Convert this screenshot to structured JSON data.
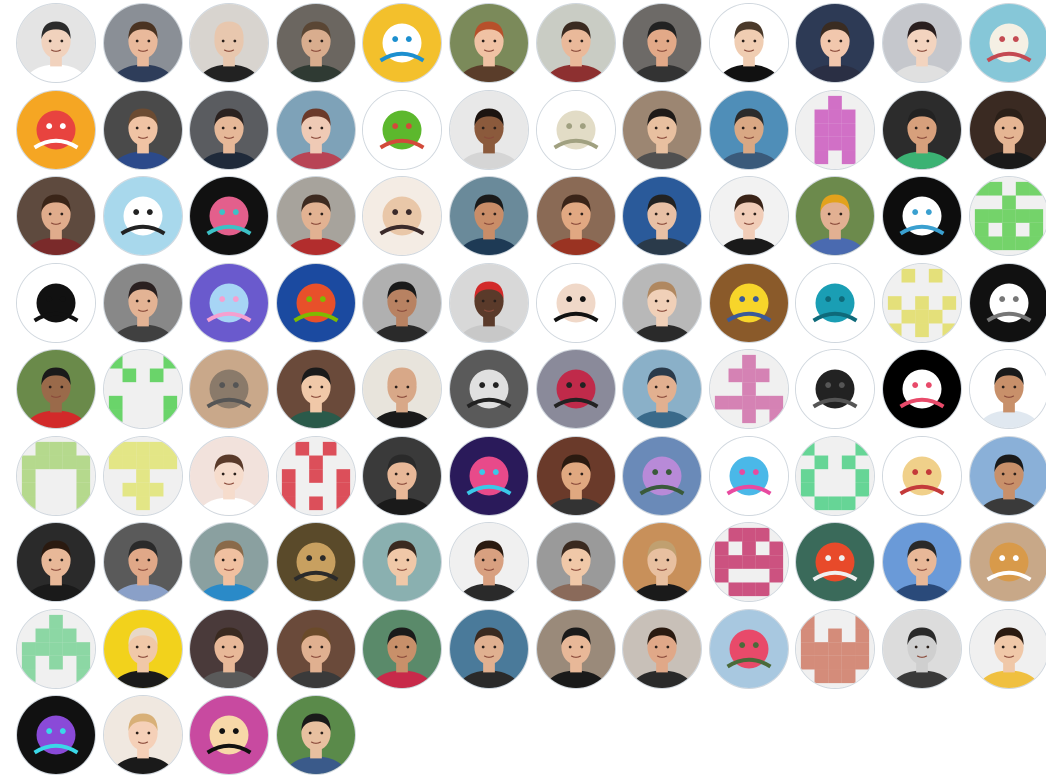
{
  "contributors": [
    {
      "kind": "photo",
      "bg": "#e4e4e4",
      "skin": "#f1d2bd",
      "hair": "#2b2b2b",
      "shirt": "#ffffff"
    },
    {
      "kind": "photo",
      "bg": "#8a8f96",
      "skin": "#e9b99b",
      "hair": "#4a3322",
      "shirt": "#2e3d5a"
    },
    {
      "kind": "photo",
      "bg": "#d8d4cf",
      "skin": "#e8c7ae",
      "hair": "#e8c7ae",
      "shirt": "#222222"
    },
    {
      "kind": "photo",
      "bg": "#6b6660",
      "skin": "#d9ad8e",
      "hair": "#5a4634",
      "shirt": "#2f3a33"
    },
    {
      "kind": "art",
      "bg": "#f3c02c",
      "fg": "#ffffff",
      "accent": "#1c8fcf"
    },
    {
      "kind": "photo",
      "bg": "#7b8a5a",
      "skin": "#f0c2a4",
      "hair": "#b7502b",
      "shirt": "#5a3d2a"
    },
    {
      "kind": "photo",
      "bg": "#c9ccc4",
      "skin": "#eab99a",
      "hair": "#3a2a20",
      "shirt": "#8d3030"
    },
    {
      "kind": "photo",
      "bg": "#6d6a67",
      "skin": "#e2a988",
      "hair": "#222222",
      "shirt": "#333333"
    },
    {
      "kind": "photo",
      "bg": "#ffffff",
      "skin": "#f0cdb2",
      "hair": "#4b3a2b",
      "shirt": "#111111"
    },
    {
      "kind": "photo",
      "bg": "#2d3a55",
      "skin": "#f1c7ad",
      "hair": "#3a2c22",
      "shirt": "#2a2f44"
    },
    {
      "kind": "photo",
      "bg": "#c5c7cc",
      "skin": "#f3d4bf",
      "hair": "#2a1f1f",
      "shirt": "#e0e0e0"
    },
    {
      "kind": "art",
      "bg": "#86c7d8",
      "fg": "#f5f0e4",
      "accent": "#c44a52"
    },
    {
      "kind": "art",
      "bg": "#f5a623",
      "fg": "#e8433f",
      "accent": "#ffffff"
    },
    {
      "kind": "photo",
      "bg": "#4a4a4a",
      "skin": "#f0c3a4",
      "hair": "#6b4b32",
      "shirt": "#2c4a8a"
    },
    {
      "kind": "photo",
      "bg": "#5a5c60",
      "skin": "#e6b898",
      "hair": "#2b2220",
      "shirt": "#1f2a3a"
    },
    {
      "kind": "photo",
      "bg": "#7ea2b8",
      "skin": "#efcab5",
      "hair": "#6b3a2a",
      "shirt": "#b84455"
    },
    {
      "kind": "art",
      "bg": "#ffffff",
      "fg": "#5cb82d",
      "accent": "#d24a3a"
    },
    {
      "kind": "photo",
      "bg": "#e8e8e8",
      "skin": "#8b5a3c",
      "hair": "#1c1410",
      "shirt": "#d5d5d5"
    },
    {
      "kind": "art",
      "bg": "#ffffff",
      "fg": "#e2dcc6",
      "accent": "#a0a080"
    },
    {
      "kind": "photo",
      "bg": "#9c8672",
      "skin": "#e8c0a0",
      "hair": "#1e1a18",
      "shirt": "#505050"
    },
    {
      "kind": "photo",
      "bg": "#4f8eb8",
      "skin": "#d9a884",
      "hair": "#2b2b2b",
      "shirt": "#3a5a7a"
    },
    {
      "kind": "identicon",
      "bg": "#f0f0f0",
      "fg": "#d170c6",
      "pattern": "0010001110011100111001010"
    },
    {
      "kind": "photo",
      "bg": "#2c2c2c",
      "skin": "#d7a07c",
      "hair": "#222222",
      "shirt": "#3bb273"
    },
    {
      "kind": "photo",
      "bg": "#3a2a22",
      "skin": "#e5b593",
      "hair": "#2a1f18",
      "shirt": "#1a1a1a"
    },
    {
      "kind": "photo",
      "bg": "#5e4a3e",
      "skin": "#e0ac8c",
      "hair": "#3a2518",
      "shirt": "#7a2a2a"
    },
    {
      "kind": "art",
      "bg": "#a8d8ec",
      "fg": "#ffffff",
      "accent": "#222222"
    },
    {
      "kind": "art",
      "bg": "#111111",
      "fg": "#e35f8c",
      "accent": "#3cc1c6"
    },
    {
      "kind": "photo",
      "bg": "#a7a39c",
      "skin": "#e2b292",
      "hair": "#3d2a20",
      "shirt": "#b22d2d"
    },
    {
      "kind": "art",
      "bg": "#f4ece4",
      "fg": "#e9c7a8",
      "accent": "#3a2a2a"
    },
    {
      "kind": "photo",
      "bg": "#6a8a9a",
      "skin": "#c98d68",
      "hair": "#1a1a1a",
      "shirt": "#1e3a55"
    },
    {
      "kind": "photo",
      "bg": "#8a6a55",
      "skin": "#e1a882",
      "hair": "#3a2418",
      "shirt": "#9a3322"
    },
    {
      "kind": "photo",
      "bg": "#2a5a9a",
      "skin": "#e8c0a5",
      "hair": "#222222",
      "shirt": "#2a3a4a"
    },
    {
      "kind": "photo",
      "bg": "#f2f2f2",
      "skin": "#f1cdb8",
      "hair": "#3a2418",
      "shirt": "#1a1a1a"
    },
    {
      "kind": "photo",
      "bg": "#6c8a4c",
      "skin": "#e2b092",
      "hair": "#e2a21c",
      "shirt": "#4a6ab0"
    },
    {
      "kind": "art",
      "bg": "#0d0d0d",
      "fg": "#ffffff",
      "accent": "#3aa0d0"
    },
    {
      "kind": "identicon",
      "bg": "#f0f0f0",
      "fg": "#74d36a",
      "pattern": "1101100100111111010111111"
    },
    {
      "kind": "art",
      "bg": "#ffffff",
      "fg": "#111111",
      "accent": "#111111"
    },
    {
      "kind": "photo",
      "bg": "#888888",
      "skin": "#e3b394",
      "hair": "#2a2020",
      "shirt": "#404040"
    },
    {
      "kind": "art",
      "bg": "#6a5acd",
      "fg": "#a7d5f5",
      "accent": "#f5a0d0"
    },
    {
      "kind": "art",
      "bg": "#1b4aa0",
      "fg": "#e8502a",
      "accent": "#7fba00"
    },
    {
      "kind": "photo",
      "bg": "#b0b0b0",
      "skin": "#b88262",
      "hair": "#1a1a1a",
      "shirt": "#2a2a2a"
    },
    {
      "kind": "photo",
      "bg": "#d8d8d8",
      "skin": "#5a3a2a",
      "hair": "#d22a2a",
      "shirt": "#c8c8c8"
    },
    {
      "kind": "art",
      "bg": "#ffffff",
      "fg": "#f0d8c8",
      "accent": "#111111"
    },
    {
      "kind": "photo",
      "bg": "#b8b8b8",
      "skin": "#f0d0b8",
      "hair": "#b08860",
      "shirt": "#2a2a2a"
    },
    {
      "kind": "art",
      "bg": "#8a5a2a",
      "fg": "#f7d52a",
      "accent": "#3a5a9a"
    },
    {
      "kind": "art",
      "bg": "#ffffff",
      "fg": "#1a9eb4",
      "accent": "#0e6a7a"
    },
    {
      "kind": "identicon",
      "bg": "#f0f0f0",
      "fg": "#e4e07a",
      "pattern": "0101000000101010111010101"
    },
    {
      "kind": "art",
      "bg": "#111111",
      "fg": "#ffffff",
      "accent": "#777777"
    },
    {
      "kind": "photo",
      "bg": "#6a8a4a",
      "skin": "#9a6a4a",
      "hair": "#1a1a1a",
      "shirt": "#d22a2a"
    },
    {
      "kind": "identicon",
      "bg": "#f0f0f0",
      "fg": "#6ad46a",
      "pattern": "1000101010000001000110001"
    },
    {
      "kind": "art",
      "bg": "#c9a88a",
      "fg": "#8a7a6a",
      "accent": "#555555"
    },
    {
      "kind": "photo",
      "bg": "#6a4a3a",
      "skin": "#f0c8a8",
      "hair": "#1a1a1a",
      "shirt": "#2a5a4a"
    },
    {
      "kind": "photo",
      "bg": "#e8e4dc",
      "skin": "#d8a888",
      "hair": "#d8a888",
      "shirt": "#1a1a1a"
    },
    {
      "kind": "art",
      "bg": "#5a5a5a",
      "fg": "#e0e0e0",
      "accent": "#222222"
    },
    {
      "kind": "art",
      "bg": "#8a8a9a",
      "fg": "#c02a4a",
      "accent": "#222222"
    },
    {
      "kind": "photo",
      "bg": "#8ab0c8",
      "skin": "#e2b090",
      "hair": "#2a3a4a",
      "shirt": "#3a6a8a"
    },
    {
      "kind": "identicon",
      "bg": "#f0f0f0",
      "fg": "#d582b4",
      "pattern": "0010001110001001111100101"
    },
    {
      "kind": "art",
      "bg": "#ffffff",
      "fg": "#222222",
      "accent": "#555555"
    },
    {
      "kind": "art",
      "bg": "#000000",
      "fg": "#ffffff",
      "accent": "#e84a6a"
    },
    {
      "kind": "photo",
      "bg": "#ffffff",
      "skin": "#c8906a",
      "hair": "#1a1a1a",
      "shirt": "#e0e8f0"
    },
    {
      "kind": "identicon",
      "bg": "#f0f0f0",
      "fg": "#b5d98d",
      "pattern": "0111011111100011000110001"
    },
    {
      "kind": "identicon",
      "bg": "#f0f0f0",
      "fg": "#e3e686",
      "pattern": "1111111111001000111000100"
    },
    {
      "kind": "photo",
      "bg": "#f2e2dc",
      "skin": "#f6dccc",
      "hair": "#5a3a2a",
      "shirt": "#ffffff"
    },
    {
      "kind": "identicon",
      "bg": "#f0f0f0",
      "fg": "#dc4f5a",
      "pattern": "0101000100101011000110101"
    },
    {
      "kind": "photo",
      "bg": "#3a3a3a",
      "skin": "#e8b898",
      "hair": "#2a2a2a",
      "shirt": "#1a1a1a"
    },
    {
      "kind": "art",
      "bg": "#2a1a5a",
      "fg": "#e84a8a",
      "accent": "#3ac8e8"
    },
    {
      "kind": "photo",
      "bg": "#6a3a2a",
      "skin": "#e0a880",
      "hair": "#2a1a10",
      "shirt": "#333333"
    },
    {
      "kind": "art",
      "bg": "#6a8ab8",
      "fg": "#b88ad8",
      "accent": "#3a5a3a"
    },
    {
      "kind": "art",
      "bg": "#ffffff",
      "fg": "#4ab8e8",
      "accent": "#e84aa0"
    },
    {
      "kind": "identicon",
      "bg": "#f0f0f0",
      "fg": "#66d596",
      "pattern": "1000101010100011000101110"
    },
    {
      "kind": "art",
      "bg": "#ffffff",
      "fg": "#f0d08a",
      "accent": "#c43a3a"
    },
    {
      "kind": "photo",
      "bg": "#8ab0d8",
      "skin": "#c8906a",
      "hair": "#1a1a1a",
      "shirt": "#3a3a3a"
    },
    {
      "kind": "photo",
      "bg": "#2a2a2a",
      "skin": "#e8b898",
      "hair": "#2a1a10",
      "shirt": "#1a1a1a"
    },
    {
      "kind": "photo",
      "bg": "#5a5a5a",
      "skin": "#e0a888",
      "hair": "#2a2a2a",
      "shirt": "#8aa0c8"
    },
    {
      "kind": "photo",
      "bg": "#8aa0a0",
      "skin": "#f0c0a0",
      "hair": "#8a6a4a",
      "shirt": "#2a8ac8"
    },
    {
      "kind": "art",
      "bg": "#5a4a2a",
      "fg": "#c8a060",
      "accent": "#2a2a2a"
    },
    {
      "kind": "photo",
      "bg": "#8ab0b0",
      "skin": "#f0c8a8",
      "hair": "#3a2a20",
      "shirt": "#8ab0b0"
    },
    {
      "kind": "photo",
      "bg": "#f0f0f0",
      "skin": "#d8a080",
      "hair": "#2a1a10",
      "shirt": "#2a2a2a"
    },
    {
      "kind": "photo",
      "bg": "#9a9a9a",
      "skin": "#f0c8a8",
      "hair": "#3a2a20",
      "shirt": "#8a6a5a"
    },
    {
      "kind": "photo",
      "bg": "#c8905a",
      "skin": "#e8c0a0",
      "hair": "#c0a070",
      "shirt": "#1a1a1a"
    },
    {
      "kind": "identicon",
      "bg": "#f0f0f0",
      "fg": "#cc5280",
      "pattern": "0111010101111111000101110"
    },
    {
      "kind": "art",
      "bg": "#3a6a5a",
      "fg": "#e84a2a",
      "accent": "#f0f0f0"
    },
    {
      "kind": "photo",
      "bg": "#6a9ad8",
      "skin": "#e8b898",
      "hair": "#2a2a2a",
      "shirt": "#2a4a7a"
    },
    {
      "kind": "art",
      "bg": "#c8a888",
      "fg": "#d89a4a",
      "accent": "#ffffff"
    },
    {
      "kind": "identicon",
      "bg": "#f0f0f0",
      "fg": "#8cd7a4",
      "pattern": "0010001110111111010110001"
    },
    {
      "kind": "photo",
      "bg": "#f2d21c",
      "skin": "#f0c8a8",
      "hair": "#e8d8c8",
      "shirt": "#1a1a1a"
    },
    {
      "kind": "photo",
      "bg": "#4a3a3a",
      "skin": "#e8b898",
      "hair": "#3a2a20",
      "shirt": "#5a5a5a"
    },
    {
      "kind": "photo",
      "bg": "#6a4a3a",
      "skin": "#e0b090",
      "hair": "#6a4a2a",
      "shirt": "#3a3a3a"
    },
    {
      "kind": "photo",
      "bg": "#5a8a6a",
      "skin": "#c8906a",
      "hair": "#1a1a1a",
      "shirt": "#c82a4a"
    },
    {
      "kind": "photo",
      "bg": "#4a7a9a",
      "skin": "#e0b090",
      "hair": "#3a2a20",
      "shirt": "#2a2a2a"
    },
    {
      "kind": "photo",
      "bg": "#9a8a7a",
      "skin": "#e8b898",
      "hair": "#1a1a1a",
      "shirt": "#1a1a1a"
    },
    {
      "kind": "photo",
      "bg": "#c8c0b8",
      "skin": "#e0a888",
      "hair": "#2a1a10",
      "shirt": "#2a2a2a"
    },
    {
      "kind": "art",
      "bg": "#a8c8e0",
      "fg": "#e84a6a",
      "accent": "#4a6a3a"
    },
    {
      "kind": "identicon",
      "bg": "#f0f0f0",
      "fg": "#d48c7a",
      "pattern": "1000110101111111111101110"
    },
    {
      "kind": "photo",
      "bg": "#dcdcdc",
      "skin": "#cfcfcf",
      "hair": "#2a2a2a",
      "shirt": "#3a3a3a"
    },
    {
      "kind": "photo",
      "bg": "#f0f0f0",
      "skin": "#f0c8a8",
      "hair": "#2a1a10",
      "shirt": "#f0c040"
    },
    {
      "kind": "art",
      "bg": "#111111",
      "fg": "#8a4ad8",
      "accent": "#3ad8e8"
    },
    {
      "kind": "photo",
      "bg": "#f0e8e0",
      "skin": "#f5d0b8",
      "hair": "#d8b078",
      "shirt": "#1a1a1a"
    },
    {
      "kind": "art",
      "bg": "#c84aa0",
      "fg": "#f7d8a8",
      "accent": "#111111"
    },
    {
      "kind": "photo",
      "bg": "#5a8a4a",
      "skin": "#e8c0a0",
      "hair": "#1a1a1a",
      "shirt": "#3a5a8a"
    }
  ]
}
